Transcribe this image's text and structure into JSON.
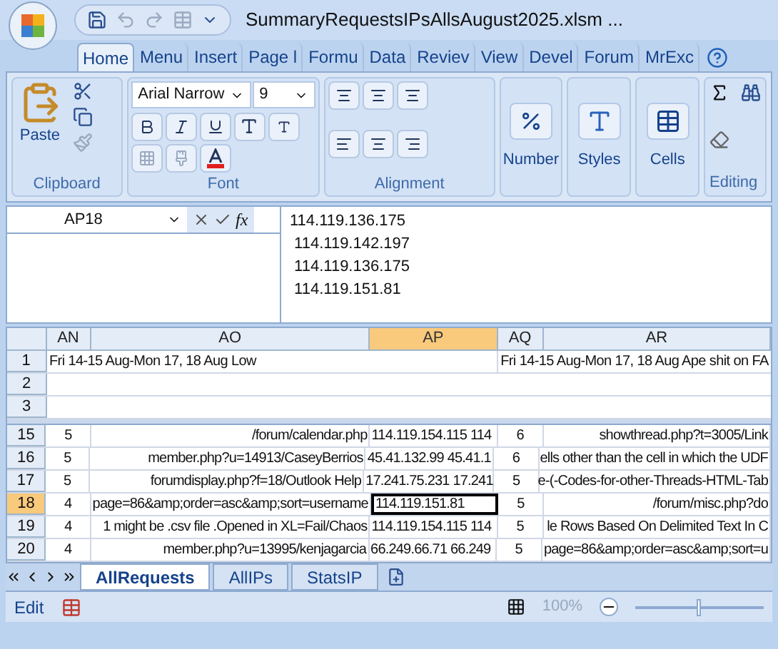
{
  "window": {
    "title": "SummaryRequestsIPsAllsAugust2025.xlsm ..."
  },
  "tabs": [
    {
      "label": "Home",
      "selected": true
    },
    {
      "label": "Menu",
      "selected": false
    },
    {
      "label": "Insert",
      "selected": false
    },
    {
      "label": "Page l",
      "selected": false
    },
    {
      "label": "Formu",
      "selected": false
    },
    {
      "label": "Data",
      "selected": false
    },
    {
      "label": "Reviev",
      "selected": false
    },
    {
      "label": "View",
      "selected": false
    },
    {
      "label": "Devel",
      "selected": false
    },
    {
      "label": "Forum",
      "selected": false
    },
    {
      "label": "MrExc",
      "selected": false
    }
  ],
  "ribbon": {
    "clipboard": {
      "label": "Clipboard",
      "paste": "Paste"
    },
    "font": {
      "label": "Font",
      "family": "Arial Narrow",
      "size": "9"
    },
    "alignment": {
      "label": "Alignment"
    },
    "number": {
      "label": "Number"
    },
    "styles": {
      "label": "Styles"
    },
    "cells": {
      "label": "Cells"
    },
    "editing": {
      "label": "Editing"
    }
  },
  "formula_bar": {
    "name_box": "AP18",
    "function_label": "fx",
    "lines": [
      "114.119.136.175",
      " 114.119.142.197",
      " 114.119.136.175",
      " 114.119.151.81"
    ]
  },
  "columns": [
    {
      "label": "AN",
      "selected": false
    },
    {
      "label": "AO",
      "selected": false
    },
    {
      "label": "AP",
      "selected": true
    },
    {
      "label": "AQ",
      "selected": false
    },
    {
      "label": "AR",
      "selected": false
    }
  ],
  "heading_row": {
    "header": "1",
    "left": "Fri 14-15 Aug-Mon 17, 18 Aug Low",
    "right": "Fri 14-15 Aug-Mon 17, 18 Aug Ape shit on FA"
  },
  "blank_rows": [
    "2",
    "3"
  ],
  "rows": [
    {
      "header": "15",
      "selected": false,
      "cells": [
        "5",
        "/forum/calendar.php",
        "114.119.154.115 114",
        "6",
        "showthread.php?t=3005/Link"
      ]
    },
    {
      "header": "16",
      "selected": false,
      "cells": [
        "5",
        "member.php?u=14913/CaseyBerrios",
        "45.41.132.99 45.41.1",
        "6",
        "ells other than the cell in which the UDF"
      ]
    },
    {
      "header": "17",
      "selected": false,
      "cells": [
        "5",
        "forumdisplay.php?f=18/Outlook Help",
        "17.241.75.231 17.241",
        "5",
        "e-(-Codes-for-other-Threads-HTML-Tab"
      ]
    },
    {
      "header": "18",
      "selected": true,
      "cells": [
        "4",
        "page=86&amp;order=asc&amp;sort=username",
        "114.119.151.81",
        "5",
        "/forum/misc.php?do"
      ]
    },
    {
      "header": "19",
      "selected": false,
      "cells": [
        "4",
        "1 might be .csv file .Opened in XL=Fail/Chaos",
        "114.119.154.115 114",
        "5",
        "le Rows Based On Delimited Text In C"
      ]
    },
    {
      "header": "20",
      "selected": false,
      "cells": [
        "4",
        "member.php?u=13995/kenjagarcia",
        "66.249.66.71 66.249",
        "5",
        "page=86&amp;order=asc&amp;sort=u"
      ]
    }
  ],
  "sheet_tabs": [
    {
      "label": "AllRequests",
      "selected": true
    },
    {
      "label": "AllIPs",
      "selected": false
    },
    {
      "label": "StatsIP",
      "selected": false
    }
  ],
  "status_bar": {
    "mode": "Edit",
    "zoom": "100%",
    "level": 0.5
  }
}
